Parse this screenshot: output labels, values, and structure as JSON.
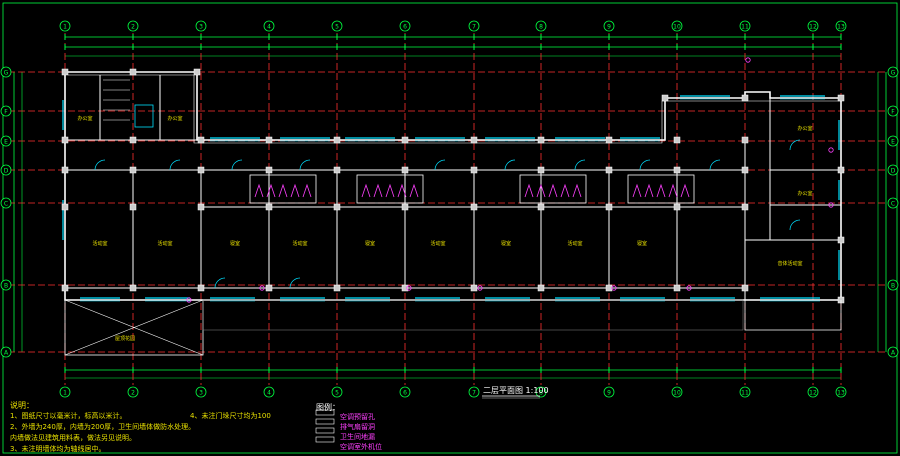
{
  "drawing": {
    "title": "二层平面图",
    "scale": "1:100",
    "grid_columns": [
      "1",
      "2",
      "3",
      "4",
      "5",
      "6",
      "7",
      "8",
      "9",
      "10",
      "11",
      "12",
      "13"
    ],
    "grid_rows": [
      "G",
      "F",
      "E",
      "D",
      "C",
      "B",
      "A"
    ],
    "rooms": [
      "办公室",
      "办公室",
      "活动室",
      "活动室",
      "寝室",
      "活动室",
      "寝室",
      "活动室",
      "寝室",
      "活动室",
      "寝室",
      "办公室",
      "办公室",
      "音体活动室"
    ],
    "annotation_label": "屋顶花园",
    "colors": {
      "grid": "#ff3030",
      "wall": "#ffffff",
      "dim": "#00ff40",
      "window": "#00e0ff",
      "column": "#ffffff",
      "text": "#e8e000",
      "pink": "#ff40ff",
      "bg": "#000000"
    }
  },
  "notes": {
    "header": "说明：",
    "items": [
      "1、图纸尺寸以毫米计，标高以米计。",
      "2、外墙为240厚，内墙为200厚，卫生间墙体做防水处理。",
      "  内墙做法见建筑用料表，做法另见说明。",
      "3、未注明墙体均为轴线居中。",
      "4、未注门垛尺寸均为100"
    ]
  },
  "legend": {
    "header": "图例：",
    "items": [
      "空调预留孔",
      "排气扇留洞",
      "卫生间地漏",
      "空调室外机位"
    ]
  }
}
